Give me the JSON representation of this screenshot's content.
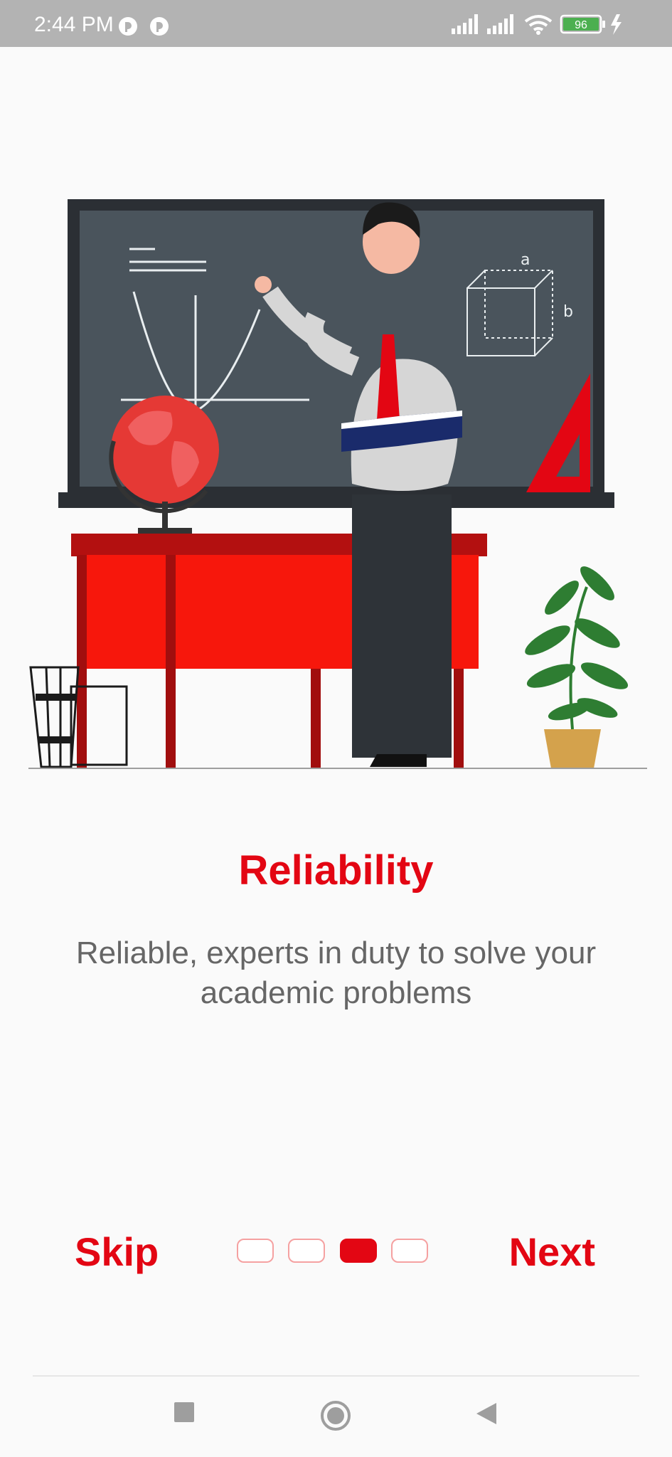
{
  "status_bar": {
    "time": "2:44 PM",
    "battery": "96",
    "icons": [
      "app-notification-icon",
      "app-notification-icon",
      "signal-icon",
      "signal-icon",
      "wifi-icon",
      "battery-icon",
      "charging-icon"
    ]
  },
  "onboarding": {
    "title": "Reliability",
    "description": "Reliable, experts in duty to solve your academic problems",
    "page_indicator": {
      "total": 4,
      "current": 3
    },
    "skip_label": "Skip",
    "next_label": "Next"
  },
  "board": {
    "label_a": "a",
    "label_b": "b"
  },
  "colors": {
    "accent": "#e30613",
    "text_muted": "#666666",
    "status_bar": "#b3b3b3"
  },
  "system_nav": {
    "buttons": [
      "recents-icon",
      "home-icon",
      "back-icon"
    ]
  }
}
